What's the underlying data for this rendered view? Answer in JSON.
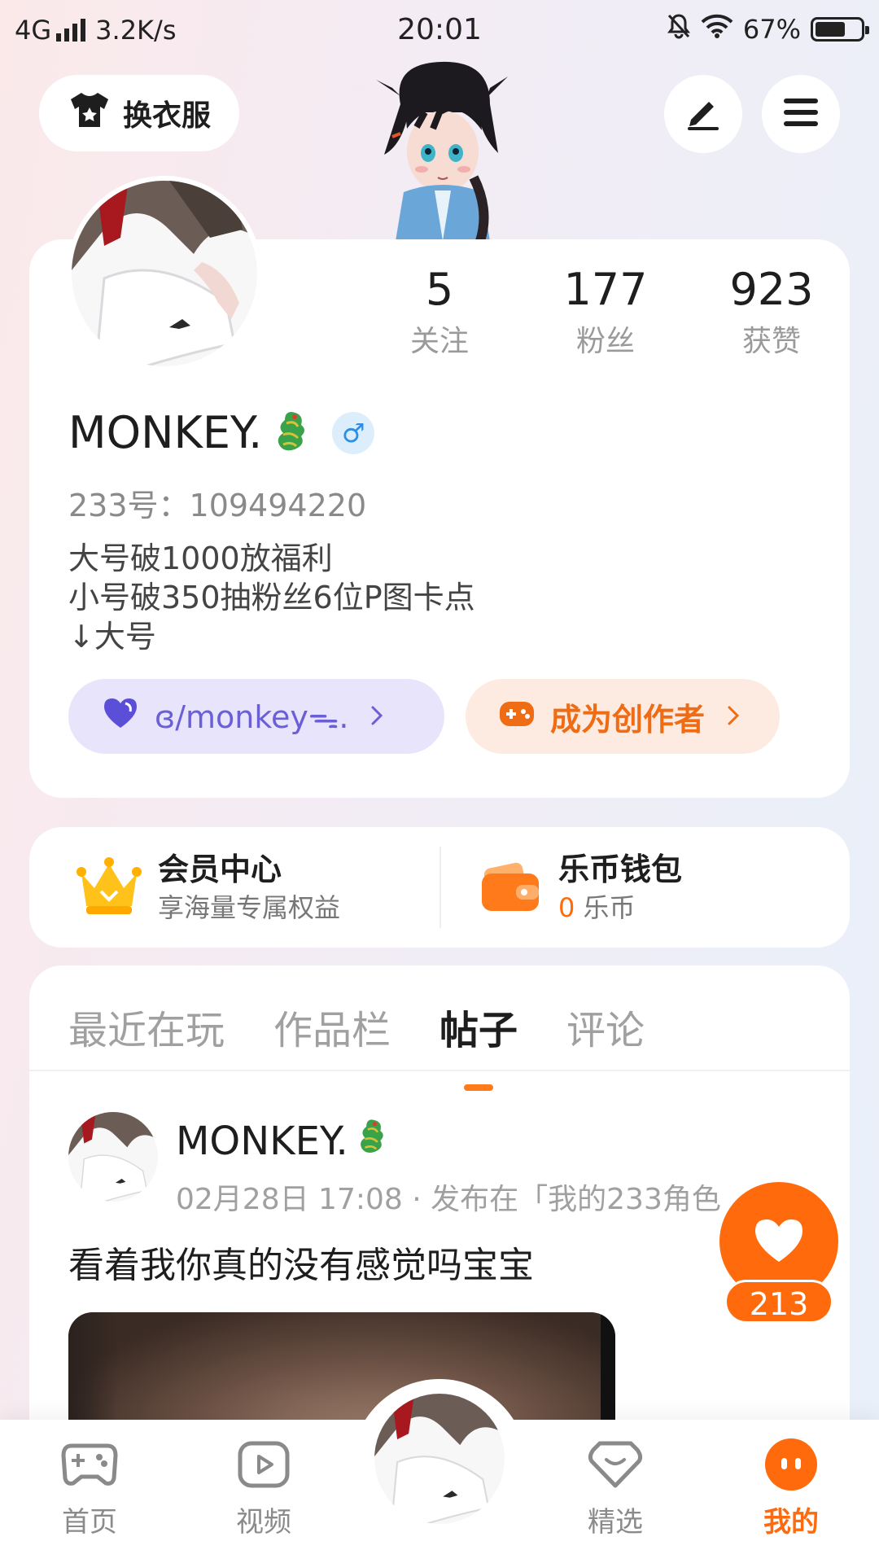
{
  "status_bar": {
    "network": "4G",
    "speed": "3.2K/s",
    "time": "20:01",
    "battery": "67%",
    "battery_level": 0.67
  },
  "header": {
    "outfit_label": "换衣服"
  },
  "profile": {
    "stats": [
      {
        "value": "5",
        "label": "关注"
      },
      {
        "value": "177",
        "label": "粉丝"
      },
      {
        "value": "923",
        "label": "获赞"
      }
    ],
    "nickname": "MONKEY.",
    "gender_symbol": "♂",
    "user_id": "233号：109494220",
    "bio": "大号破1000放福利\n小号破350抽粉丝6位P图卡点\n↓大号",
    "linked_account_label": "ɞ/monkeyᯓ.",
    "creator_label": "成为创作者"
  },
  "member": {
    "vip_title": "会员中心",
    "vip_sub": "享海量专属权益",
    "wallet_title": "乐币钱包",
    "wallet_amount": "0",
    "wallet_unit": "乐币"
  },
  "tabs": [
    "最近在玩",
    "作品栏",
    "帖子",
    "评论"
  ],
  "active_tab": 2,
  "post": {
    "author": "MONKEY.",
    "meta": "02月28日 17:08 · 发布在「我的233角色",
    "text": "看着我你真的没有感觉吗宝宝"
  },
  "like": {
    "count": "213"
  },
  "nav": {
    "items": [
      "首页",
      "视频",
      "精选",
      "我的"
    ],
    "active": 3
  },
  "colors": {
    "accent": "#ff6a0d",
    "linked_chip": "#e7e4fb",
    "creator_chip": "#fdeae0"
  }
}
